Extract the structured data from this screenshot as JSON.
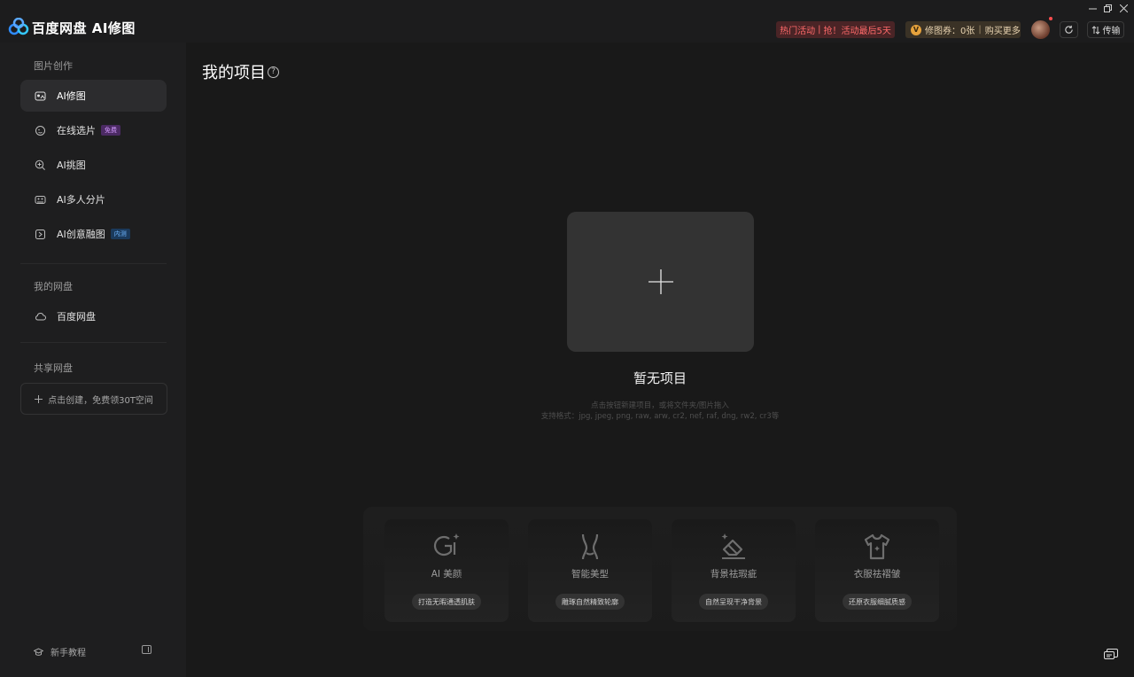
{
  "app": {
    "title": "百度网盘 AI修图"
  },
  "header": {
    "promo_label": "热门活动",
    "promo_text": "抢！活动最后5天",
    "vip_badge": "V",
    "vip_coupon": "修图券：0张",
    "vip_buy": "购买更多",
    "transfer_label": "传输",
    "icons": {
      "sync": "refresh-icon",
      "transfer": "transfer-icon",
      "minimize": "minimize-icon",
      "restore": "restore-icon",
      "close": "close-icon"
    }
  },
  "sidebar": {
    "section_create": "图片创作",
    "items": [
      {
        "label": "AI修图",
        "icon": "ai-retouch-icon",
        "active": true
      },
      {
        "label": "在线选片",
        "icon": "select-photo-icon",
        "tag": "免费"
      },
      {
        "label": "AI挑图",
        "icon": "zoom-pick-icon"
      },
      {
        "label": "AI多人分片",
        "icon": "multi-person-icon"
      },
      {
        "label": "AI创意融图",
        "icon": "creative-fusion-icon",
        "tag": "内测"
      }
    ],
    "section_my_disk": "我的网盘",
    "disk_item": {
      "label": "百度网盘",
      "icon": "cloud-icon"
    },
    "section_shared": "共享网盘",
    "create_shared": "点击创建，免费领30T空间",
    "tutorial": "新手教程"
  },
  "main": {
    "title": "我的项目",
    "empty_title": "暂无项目",
    "empty_hint": "点击按钮新建项目，或将文件夹/图片拖入",
    "empty_formats": "支持格式：jpg, jpeg, png, raw, arw, cr2, nef, raf, dng, rw2, cr3等",
    "features": [
      {
        "name": "AI 美颜",
        "chip": "打造无暇通透肌肤",
        "icon": "ai-beauty-icon"
      },
      {
        "name": "智能美型",
        "chip": "雕琢自然精致轮廓",
        "icon": "body-shape-icon"
      },
      {
        "name": "背景祛瑕疵",
        "chip": "自然呈现干净背景",
        "icon": "eraser-icon"
      },
      {
        "name": "衣服祛褶皱",
        "chip": "还原衣服细腻质感",
        "icon": "tshirt-icon"
      }
    ]
  },
  "colors": {
    "background": "#191919",
    "sidebar": "#1e1e1f",
    "promo_text": "#ff6a6a",
    "vip_gold": "#e6a23c",
    "tag_free": "#d49bff",
    "tag_beta": "#6fb6ff"
  }
}
